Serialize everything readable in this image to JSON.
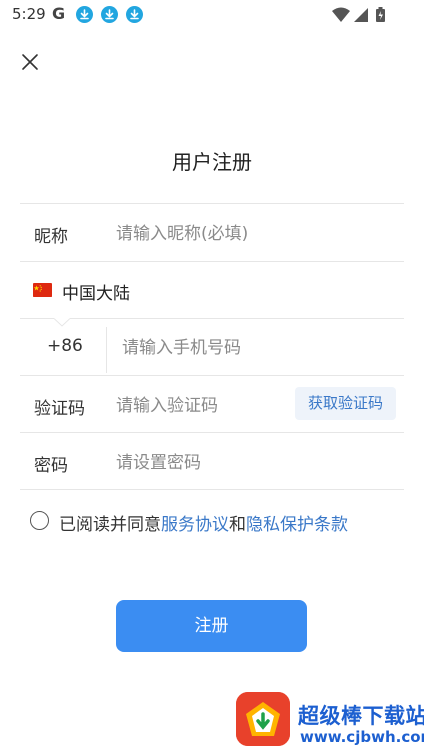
{
  "status_bar": {
    "time": "5:29",
    "google_letter": "G",
    "icons": [
      "download-icon",
      "download-icon",
      "download-icon",
      "wifi-icon",
      "signal-icon",
      "battery-icon"
    ]
  },
  "title": "用户注册",
  "form": {
    "nickname": {
      "label": "昵称",
      "placeholder": "请输入昵称(必填)"
    },
    "country": {
      "name": "中国大陆",
      "flag": "china-flag-icon"
    },
    "phone": {
      "prefix": "+86",
      "placeholder": "请输入手机号码"
    },
    "verify": {
      "label": "验证码",
      "placeholder": "请输入验证码",
      "button": "获取验证码"
    },
    "password": {
      "label": "密码",
      "placeholder": "请设置密码"
    }
  },
  "agreement": {
    "prefix": "已阅读并同意",
    "link1": "服务协议",
    "and": "和",
    "link2": "隐私保护条款"
  },
  "register_button": "注册",
  "watermark": {
    "title": "超级棒下载站",
    "url": "www.cjbwh.com"
  },
  "colors": {
    "accent": "#3b8df2",
    "link": "#3a78c8",
    "download_badge": "#22a6e0",
    "watermark_logo": "#e8412b",
    "watermark_text": "#1c5fd0"
  }
}
